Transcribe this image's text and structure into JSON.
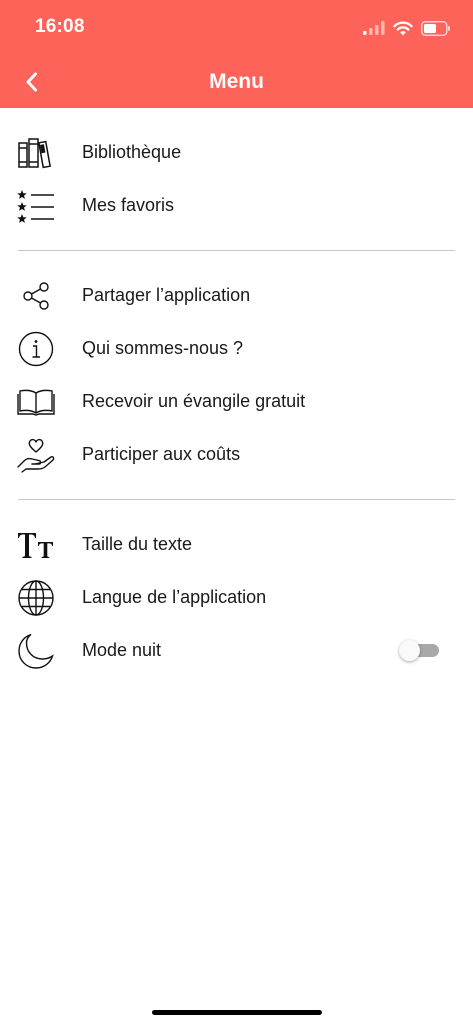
{
  "status": {
    "time": "16:08"
  },
  "nav": {
    "title": "Menu"
  },
  "colors": {
    "accent": "#fd6359",
    "divider": "#c8c8c8",
    "toggle_off": "#a8a8a8"
  },
  "sections": [
    {
      "items": [
        {
          "label": "Bibliothèque",
          "icon": "books-icon"
        },
        {
          "label": "Mes favoris",
          "icon": "starred-list-icon"
        }
      ]
    },
    {
      "items": [
        {
          "label": "Partager l’application",
          "icon": "share-icon"
        },
        {
          "label": "Qui sommes-nous ?",
          "icon": "info-icon"
        },
        {
          "label": "Recevoir un évangile gratuit",
          "icon": "open-book-icon"
        },
        {
          "label": "Participer aux coûts",
          "icon": "heart-hand-icon"
        }
      ]
    },
    {
      "items": [
        {
          "label": "Taille du texte",
          "icon": "text-size-icon"
        },
        {
          "label": "Langue de l’application",
          "icon": "globe-icon"
        },
        {
          "label": "Mode nuit",
          "icon": "moon-icon",
          "toggle": "off"
        }
      ]
    }
  ]
}
